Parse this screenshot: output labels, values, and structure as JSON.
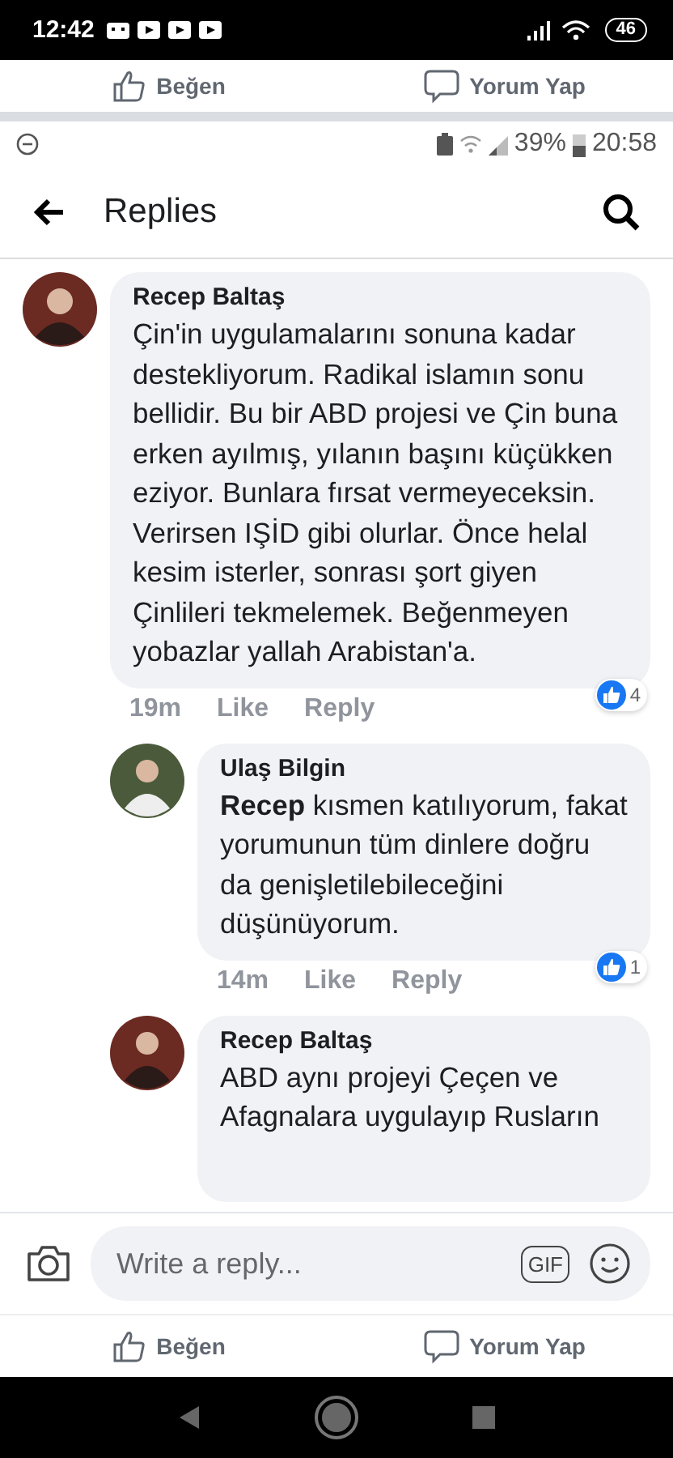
{
  "device_status_bar": {
    "time": "12:42",
    "battery": "46"
  },
  "previous_post_actions": [
    {
      "kind": "like",
      "label": "Beğen"
    },
    {
      "kind": "comment",
      "label": "Yorum Yap"
    }
  ],
  "inner_status_bar": {
    "battery": "39%",
    "time": "20:58"
  },
  "header": {
    "title": "Replies"
  },
  "comments": [
    {
      "author": "Recep Baltaş",
      "text": "Çin'in uygulamalarını sonuna kadar destekliyorum. Radikal islamın sonu bellidir. Bu bir ABD projesi ve Çin buna erken ayılmış, yılanın başını küçükken eziyor. Bunlara fırsat vermeyeceksin. Verirsen IŞİD gibi olurlar. Önce helal kesim isterler, sonrası şort giyen Çinlileri tekmelemek. Beğenmeyen yobazlar yallah Arabistan'a.",
      "time": "19m",
      "actions": [
        "Like",
        "Reply"
      ],
      "reactions": "4",
      "children": [
        {
          "author": "Ulaş Bilgin",
          "text": "**Recep** kısmen katılıyorum, fakat yorumunun tüm dinlere doğru da genişletilebileceğini düşünüyorum.",
          "time": "14m",
          "actions": [
            "Like",
            "Reply"
          ],
          "reactions": "1"
        },
        {
          "author": "Recep Baltaş",
          "text": "ABD aynı projeyi Çeçen ve Afagnalara uygulayıp Rusların"
        }
      ]
    }
  ],
  "composer": {
    "placeholder": "Write a reply...",
    "gif": "GIF"
  },
  "bottom_actions": [
    {
      "kind": "like",
      "label": "Beğen"
    },
    {
      "kind": "comment",
      "label": "Yorum Yap"
    }
  ]
}
